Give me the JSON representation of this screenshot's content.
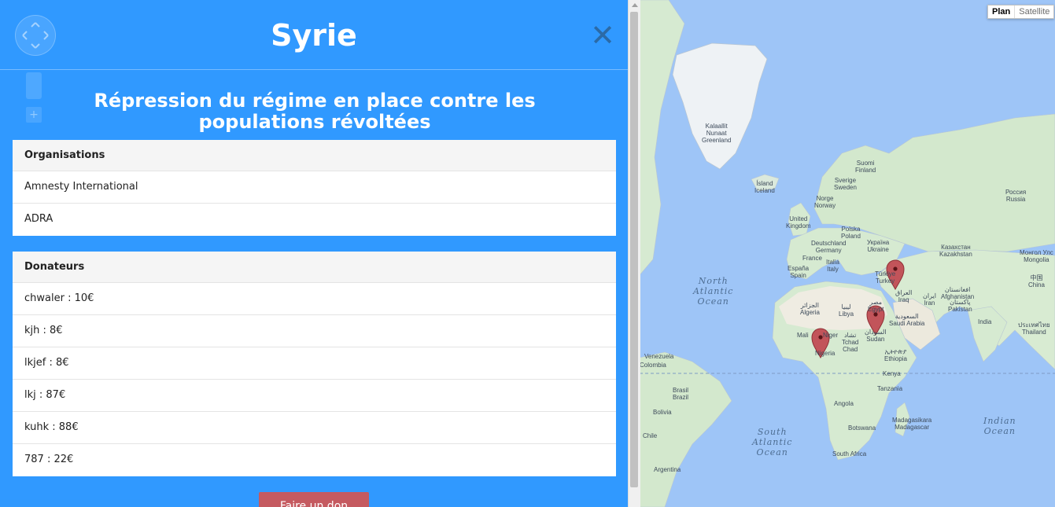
{
  "panel": {
    "title": "Syrie",
    "close_label": "✕",
    "subtitle": "Répression du régime en place contre les populations révoltées",
    "organisations": {
      "header": "Organisations",
      "items": [
        "Amnesty International",
        "ADRA"
      ]
    },
    "donateurs": {
      "header": "Donateurs",
      "items": [
        "chwaler : 10€",
        "kjh : 8€",
        "lkjef : 8€",
        "lkj : 87€",
        "kuhk : 88€",
        "787 : 22€"
      ]
    },
    "cta_label": "Faire un don"
  },
  "map": {
    "map_type": {
      "plan": "Plan",
      "satellite": "Satellite"
    },
    "oceans": {
      "north_atlantic": "North\nAtlantic\nOcean",
      "south_atlantic": "South\nAtlantic\nOcean",
      "indian": "Indian\nOcean"
    },
    "labels": {
      "greenland": "Kalaallit\nNunaat\nGreenland",
      "iceland": "Ísland\nIceland",
      "suomi": "Suomi\nFinland",
      "sverige": "Sverige\nSweden",
      "norge": "Norge\nNorway",
      "russia": "Россия\nRussia",
      "uk": "United\nKingdom",
      "polska": "Polska\nPoland",
      "deutschland": "Deutschland\nGermany",
      "ukraine": "Україна\nUkraine",
      "kazakhstan": "Казахстан\nKazakhstan",
      "mongolia": "Монгол Улс\nMongolia",
      "france": "France",
      "italia": "Italia\nItaly",
      "espana": "España\nSpain",
      "turkey": "Türkiye\nTurkey",
      "china": "中国\nChina",
      "iraq": "العراق\nIraq",
      "iran": "ایران\nIran",
      "afghanistan": "افغانستان\nAfghanistan",
      "pakistan": "پاکستان\nPakistan",
      "algeria": "الجزائر\nAlgeria",
      "libya": "ليبيا\nLibya",
      "egypt": "مصر\nEgypt",
      "saudi": "السعودية\nSaudi Arabia",
      "india": "India",
      "thailand": "ประเทศไทย\nThailand",
      "mali": "Mali",
      "niger": "Niger",
      "chad": "تشاد\nTchad\nChad",
      "sudan": "السودان\nSudan",
      "nigeria": "Nigeria",
      "ethiopia": "ኢትዮጵያ\nEthiopia",
      "kenya": "Kenya",
      "tanzania": "Tanzania",
      "angola": "Angola",
      "botswana": "Botswana",
      "madagascar": "Madagasikara\nMadagascar",
      "south_africa": "South Africa",
      "venezuela": "Venezuela",
      "colombia": "Colombia",
      "brasil": "Brasil\nBrazil",
      "bolivia": "Bolivia",
      "chile": "Chile",
      "argentina": "Argentina"
    },
    "marker_color": "#c2545a"
  },
  "colors": {
    "panel_bg": "#2896ff",
    "ocean": "#9ec5f7",
    "land": "#cde8c8",
    "desert": "#eeebe0",
    "cta": "#c55a60"
  }
}
